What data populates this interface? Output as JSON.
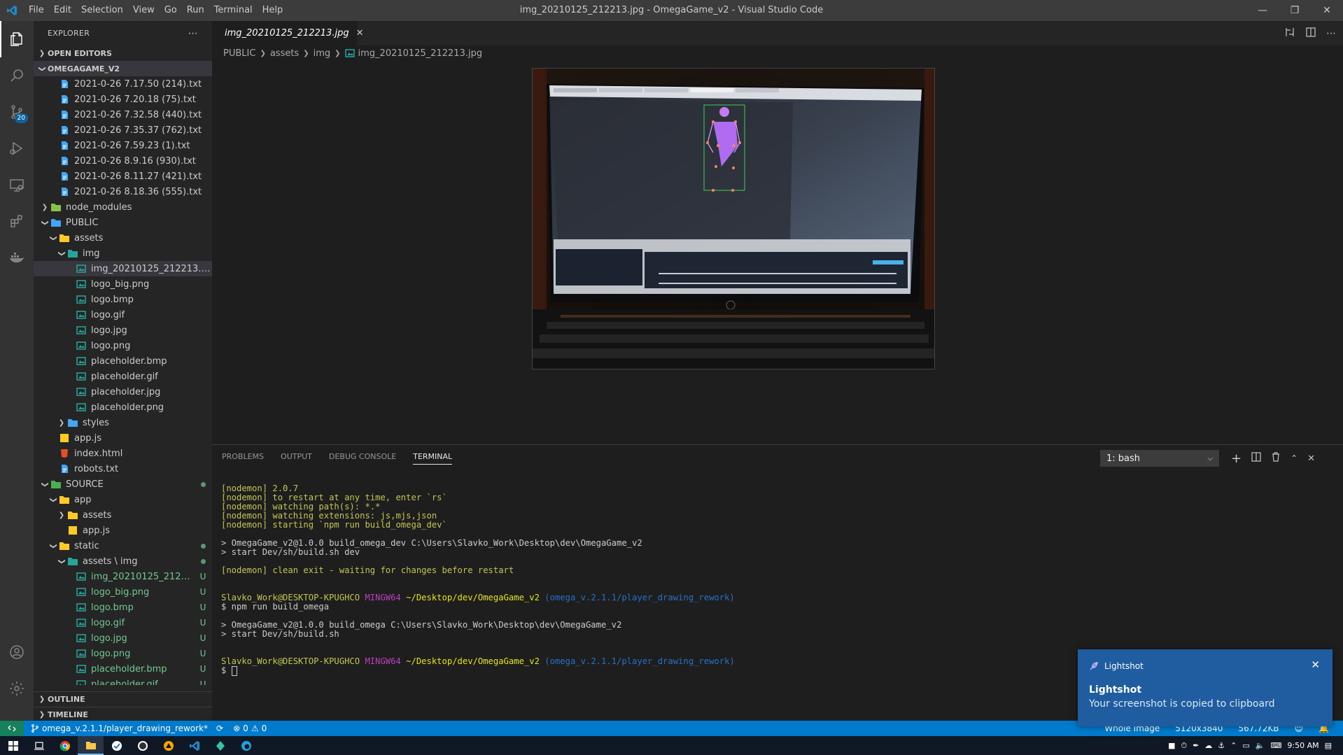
{
  "window": {
    "title": "img_20210125_212213.jpg - OmegaGame_v2 - Visual Studio Code",
    "menu": [
      "File",
      "Edit",
      "Selection",
      "View",
      "Go",
      "Run",
      "Terminal",
      "Help"
    ]
  },
  "activity": {
    "scm_badge": "20"
  },
  "sidebar": {
    "header": "EXPLORER",
    "open_editors": "OPEN EDITORS",
    "workspace": "OMEGAGAME_V2",
    "outline": "OUTLINE",
    "timeline": "TIMELINE",
    "tree": [
      {
        "label": "2021-0-26 7.17.50 (214).txt",
        "indent": 2,
        "kind": "txt"
      },
      {
        "label": "2021-0-26 7.20.18 (75).txt",
        "indent": 2,
        "kind": "txt"
      },
      {
        "label": "2021-0-26 7.32.58 (440).txt",
        "indent": 2,
        "kind": "txt"
      },
      {
        "label": "2021-0-26 7.35.37 (762).txt",
        "indent": 2,
        "kind": "txt"
      },
      {
        "label": "2021-0-26 7.59.23 (1).txt",
        "indent": 2,
        "kind": "txt"
      },
      {
        "label": "2021-0-26 8.9.16 (930).txt",
        "indent": 2,
        "kind": "txt"
      },
      {
        "label": "2021-0-26 8.11.27 (421).txt",
        "indent": 2,
        "kind": "txt"
      },
      {
        "label": "2021-0-26 8.18.36 (555).txt",
        "indent": 2,
        "kind": "txt"
      },
      {
        "label": "node_modules",
        "indent": 1,
        "kind": "folder-node",
        "twisty": "closed"
      },
      {
        "label": "PUBLIC",
        "indent": 1,
        "kind": "folder-public",
        "twisty": "open"
      },
      {
        "label": "assets",
        "indent": 2,
        "kind": "folder",
        "twisty": "open"
      },
      {
        "label": "img",
        "indent": 3,
        "kind": "folder-img",
        "twisty": "open"
      },
      {
        "label": "img_20210125_212213.jpg",
        "indent": 4,
        "kind": "img",
        "selected": true
      },
      {
        "label": "logo_big.png",
        "indent": 4,
        "kind": "img"
      },
      {
        "label": "logo.bmp",
        "indent": 4,
        "kind": "img"
      },
      {
        "label": "logo.gif",
        "indent": 4,
        "kind": "img"
      },
      {
        "label": "logo.jpg",
        "indent": 4,
        "kind": "img"
      },
      {
        "label": "logo.png",
        "indent": 4,
        "kind": "img"
      },
      {
        "label": "placeholder.bmp",
        "indent": 4,
        "kind": "img"
      },
      {
        "label": "placeholder.gif",
        "indent": 4,
        "kind": "img"
      },
      {
        "label": "placeholder.jpg",
        "indent": 4,
        "kind": "img"
      },
      {
        "label": "placeholder.png",
        "indent": 4,
        "kind": "img"
      },
      {
        "label": "styles",
        "indent": 3,
        "kind": "folder-styles",
        "twisty": "closed"
      },
      {
        "label": "app.js",
        "indent": 2,
        "kind": "js"
      },
      {
        "label": "index.html",
        "indent": 2,
        "kind": "html"
      },
      {
        "label": "robots.txt",
        "indent": 2,
        "kind": "txt"
      },
      {
        "label": "SOURCE",
        "indent": 1,
        "kind": "folder-source",
        "twisty": "open",
        "dot": true
      },
      {
        "label": "app",
        "indent": 2,
        "kind": "folder",
        "twisty": "open"
      },
      {
        "label": "assets",
        "indent": 3,
        "kind": "folder",
        "twisty": "closed"
      },
      {
        "label": "app.js",
        "indent": 3,
        "kind": "js"
      },
      {
        "label": "static",
        "indent": 2,
        "kind": "folder",
        "twisty": "open",
        "dot": true
      },
      {
        "label": "assets \\ img",
        "indent": 3,
        "kind": "folder-img",
        "twisty": "open",
        "dot": true
      },
      {
        "label": "img_20210125_212213.j...",
        "indent": 4,
        "kind": "img",
        "green": true,
        "deco": "U"
      },
      {
        "label": "logo_big.png",
        "indent": 4,
        "kind": "img",
        "green": true,
        "deco": "U"
      },
      {
        "label": "logo.bmp",
        "indent": 4,
        "kind": "img",
        "green": true,
        "deco": "U"
      },
      {
        "label": "logo.gif",
        "indent": 4,
        "kind": "img",
        "green": true,
        "deco": "U"
      },
      {
        "label": "logo.jpg",
        "indent": 4,
        "kind": "img",
        "green": true,
        "deco": "U"
      },
      {
        "label": "logo.png",
        "indent": 4,
        "kind": "img",
        "green": true,
        "deco": "U"
      },
      {
        "label": "placeholder.bmp",
        "indent": 4,
        "kind": "img",
        "green": true,
        "deco": "U"
      },
      {
        "label": "placeholder.gif",
        "indent": 4,
        "kind": "img",
        "green": true,
        "deco": "U"
      }
    ]
  },
  "editor": {
    "tab_label": "img_20210125_212213.jpg",
    "breadcrumb": [
      "PUBLIC",
      "assets",
      "img",
      "img_20210125_212213.jpg"
    ]
  },
  "panel": {
    "tabs": [
      "PROBLEMS",
      "OUTPUT",
      "DEBUG CONSOLE",
      "TERMINAL"
    ],
    "active_tab": "TERMINAL",
    "terminal_select": "1: bash",
    "lines": [
      {
        "parts": [
          {
            "t": "[nodemon] 2.0.7",
            "c": "y"
          }
        ]
      },
      {
        "parts": [
          {
            "t": "[nodemon] to restart at any time, enter `rs`",
            "c": "y"
          }
        ]
      },
      {
        "parts": [
          {
            "t": "[nodemon] watching path(s): *.*",
            "c": "y"
          }
        ]
      },
      {
        "parts": [
          {
            "t": "[nodemon] watching extensions: js,mjs,json",
            "c": "y"
          }
        ]
      },
      {
        "parts": [
          {
            "t": "[nodemon] starting `npm run build_omega_dev`",
            "c": "y"
          }
        ]
      },
      {
        "parts": [
          {
            "t": "",
            "c": ""
          }
        ]
      },
      {
        "parts": [
          {
            "t": "> OmegaGame_v2@1.0.0 build_omega_dev C:\\Users\\Slavko_Work\\Desktop\\dev\\OmegaGame_v2",
            "c": ""
          }
        ]
      },
      {
        "parts": [
          {
            "t": "> start Dev/sh/build.sh dev",
            "c": ""
          }
        ]
      },
      {
        "parts": [
          {
            "t": "",
            "c": ""
          }
        ]
      },
      {
        "parts": [
          {
            "t": "[nodemon] clean exit - waiting for changes before restart",
            "c": "y"
          }
        ]
      },
      {
        "parts": [
          {
            "t": "",
            "c": ""
          }
        ]
      },
      {
        "parts": [
          {
            "t": "",
            "c": ""
          }
        ]
      },
      {
        "parts": [
          {
            "t": "Slavko_Work@DESKTOP-KPUGHCO ",
            "c": "y"
          },
          {
            "t": "MINGW64 ",
            "c": "m"
          },
          {
            "t": "~/Desktop/dev/OmegaGame_v2 ",
            "c": "yel"
          },
          {
            "t": "(omega_v.2.1.1/player_drawing_rework)",
            "c": "b"
          }
        ]
      },
      {
        "parts": [
          {
            "t": "$ npm run build_omega",
            "c": ""
          }
        ]
      },
      {
        "parts": [
          {
            "t": "",
            "c": ""
          }
        ]
      },
      {
        "parts": [
          {
            "t": "> OmegaGame_v2@1.0.0 build_omega C:\\Users\\Slavko_Work\\Desktop\\dev\\OmegaGame_v2",
            "c": ""
          }
        ]
      },
      {
        "parts": [
          {
            "t": "> start Dev/sh/build.sh",
            "c": ""
          }
        ]
      },
      {
        "parts": [
          {
            "t": "",
            "c": ""
          }
        ]
      },
      {
        "parts": [
          {
            "t": "",
            "c": ""
          }
        ]
      },
      {
        "parts": [
          {
            "t": "Slavko_Work@DESKTOP-KPUGHCO ",
            "c": "y"
          },
          {
            "t": "MINGW64 ",
            "c": "m"
          },
          {
            "t": "~/Desktop/dev/OmegaGame_v2 ",
            "c": "yel"
          },
          {
            "t": "(omega_v.2.1.1/player_drawing_rework)",
            "c": "b"
          }
        ]
      },
      {
        "parts": [
          {
            "t": "$ ",
            "c": ""
          }
        ],
        "cursor": true
      }
    ]
  },
  "statusbar": {
    "branch": "omega_v.2.1.1/player_drawing_rework*",
    "errors": "0",
    "warnings": "0",
    "right": [
      "Whole Image",
      "5120x3840",
      "567.72KB"
    ]
  },
  "taskbar": {
    "time": "9:50 AM"
  },
  "toast": {
    "app": "Lightshot",
    "title": "Lightshot",
    "message": "Your screenshot is copied to clipboard",
    "close": "✕"
  },
  "colors": {
    "accent": "#007acc",
    "git_untracked": "#73c991",
    "toast_bg": "#1f5da0"
  }
}
